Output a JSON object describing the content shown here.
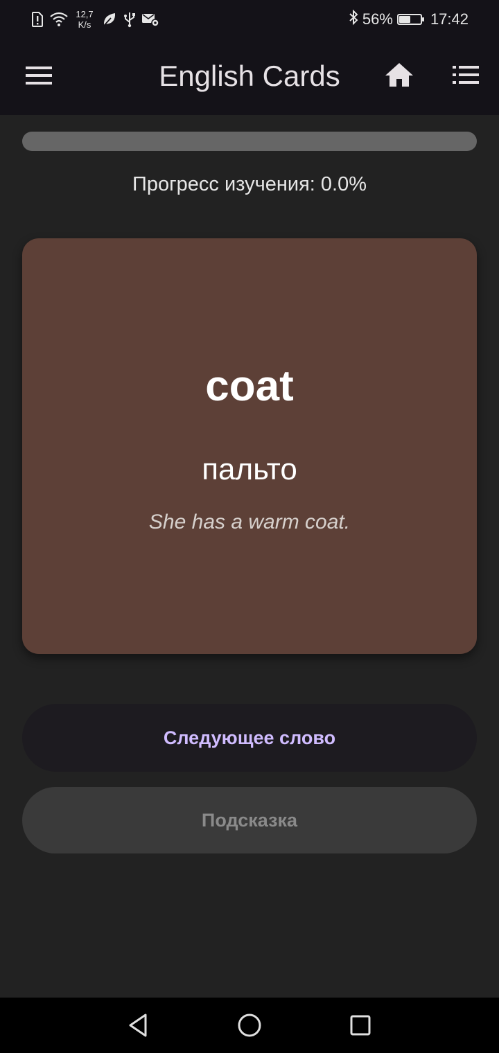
{
  "status_bar": {
    "net_speed_value": "12,7",
    "net_speed_unit": "K/s",
    "battery_percent": "56%",
    "battery_level": 0.56,
    "time": "17:42",
    "icons": [
      "sim-alert-icon",
      "wifi-icon",
      "leaf-icon",
      "usb-icon",
      "mail-settings-icon",
      "bluetooth-icon",
      "battery-charging-icon"
    ]
  },
  "app_bar": {
    "title": "English Cards",
    "icons": [
      "menu-icon",
      "home-icon",
      "list-icon"
    ]
  },
  "progress": {
    "label": "Прогресс изучения: ",
    "value_text": "0.0%",
    "fraction": 0.0
  },
  "card": {
    "word": "coat",
    "translation": "пальто",
    "example": "She has a warm coat.",
    "color": "#5d4037"
  },
  "buttons": {
    "next_label": "Следующее слово",
    "hint_label": "Подсказка"
  },
  "colors": {
    "accent": "#d0bcff",
    "background": "#222222",
    "app_bar": "#141218"
  },
  "nav_bar": {
    "icons": [
      "back-icon",
      "home-circle-icon",
      "recents-icon"
    ]
  }
}
